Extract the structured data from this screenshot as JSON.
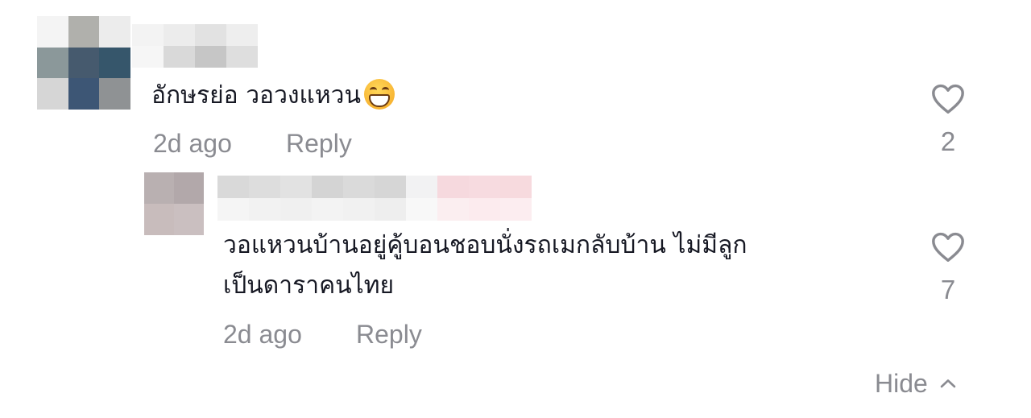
{
  "comment": {
    "text": "อักษรย่อ วอวงแหวน",
    "emoji": "grinning-face-emoji",
    "time": "2d ago",
    "reply_label": "Reply",
    "like_count": "2"
  },
  "reply": {
    "text_line1": "วอแหวนบ้านอยู่คู้บอนชอบนั่งรถเมกลับบ้าน ไม่มีลูก",
    "text_line2": "เป็นดาราคนไทย",
    "time": "2d ago",
    "reply_label": "Reply",
    "like_count": "7"
  },
  "hide_label": "Hide",
  "colors": {
    "text": "#161823",
    "muted": "#8a8b91",
    "background": "#ffffff"
  },
  "icons": [
    "heart-outline-icon",
    "chevron-up-icon"
  ],
  "redacted": {
    "comment_avatar": [
      "#f4f4f4",
      "#b0b0ac",
      "#ececec",
      "#8b989a",
      "#465a6e",
      "#36566b",
      "#d6d6d6",
      "#3d5675",
      "#8f9294"
    ],
    "comment_username": [
      "#f3f3f3",
      "#ececec",
      "#e2e2e2",
      "#eeeeee",
      "#f6f6f6",
      "#d9d9d9",
      "#c6c6c6",
      "#dedede"
    ],
    "reply_avatar": [
      "#b9b0b1",
      "#b2a8aa",
      "#c8bcbc",
      "#cabfc0"
    ],
    "reply_username": [
      "#d9d9d9",
      "#dddddd",
      "#e2e2e2",
      "#d4d4d4",
      "#dadada",
      "#d6d6d6",
      "#f2f2f3",
      "#f6d9de",
      "#f7dbe0",
      "#f7dade",
      "#f5f5f5",
      "#f2f2f2",
      "#f0f0f0",
      "#f3f3f3",
      "#f1f1f1",
      "#eeeeee",
      "#f8f8f8",
      "#fbeef0",
      "#fcebee",
      "#fcedf0"
    ]
  }
}
